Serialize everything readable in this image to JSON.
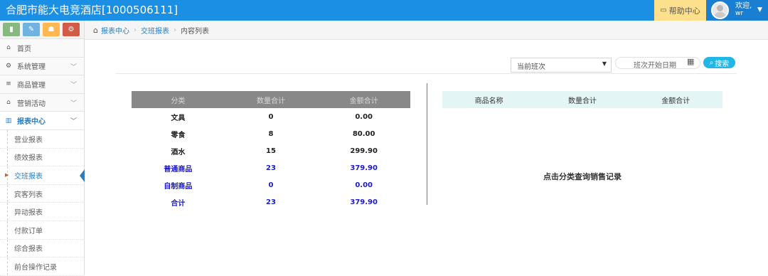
{
  "header": {
    "app_title": "合肥市能大电竞酒店[1000506111]",
    "help_label": "帮助中心",
    "welcome_label": "欢迎,",
    "username": "wr"
  },
  "sidebar": {
    "items": [
      {
        "label": "首页",
        "icon": "home-icon"
      },
      {
        "label": "系统管理",
        "icon": "gear-icon"
      },
      {
        "label": "商品管理",
        "icon": "database-icon"
      },
      {
        "label": "营销活动",
        "icon": "gift-icon"
      },
      {
        "label": "报表中心",
        "icon": "bar-chart-icon"
      }
    ],
    "subitems": [
      {
        "label": "营业报表"
      },
      {
        "label": "绩效报表"
      },
      {
        "label": "交班报表"
      },
      {
        "label": "宾客列表"
      },
      {
        "label": "异动报表"
      },
      {
        "label": "付款订单"
      },
      {
        "label": "综合报表"
      },
      {
        "label": "前台操作记录"
      }
    ],
    "active_subitem": "交班报表"
  },
  "breadcrumb": {
    "items": [
      "报表中心",
      "交班报表",
      "内容列表"
    ]
  },
  "filters": {
    "shift_select_value": "当前班次",
    "date_placeholder": "班次开始日期",
    "search_label": "搜索"
  },
  "category_table": {
    "headers": [
      "分类",
      "数量合计",
      "金额合计"
    ],
    "rows": [
      [
        "文具",
        "0",
        "0.00"
      ],
      [
        "零食",
        "8",
        "80.00"
      ],
      [
        "酒水",
        "15",
        "299.90"
      ],
      [
        "普通商品",
        "23",
        "379.90"
      ],
      [
        "自制商品",
        "0",
        "0.00"
      ],
      [
        "合计",
        "23",
        "379.90"
      ]
    ]
  },
  "product_table": {
    "headers": [
      "商品名称",
      "数量合计",
      "金额合计"
    ],
    "empty_hint": "点击分类查询销售记录"
  },
  "colors": {
    "topbar": "#1a8fe3",
    "help_button": "#fce08c",
    "link_blue": "#2b7dbc",
    "summary_row_blue": "#1a1ac8",
    "search_button": "#22b6e6"
  }
}
